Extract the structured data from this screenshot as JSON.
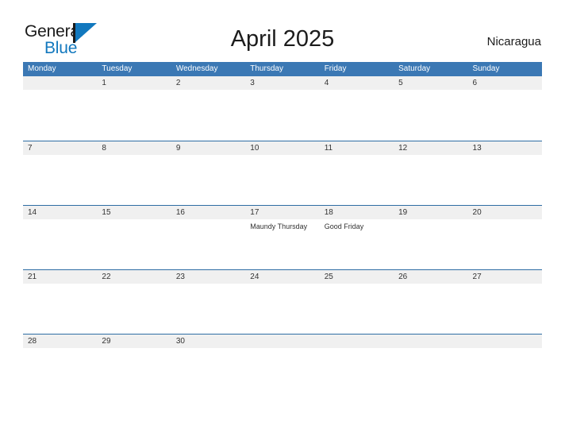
{
  "brand": {
    "name_part1": "General",
    "name_part2": "Blue",
    "triangle_color": "#1278be",
    "text_color": "#1a1a1a"
  },
  "header": {
    "title": "April 2025",
    "location": "Nicaragua",
    "header_bg": "#3b78b4",
    "row_divider_color": "#2e6da4",
    "band_color": "#f0f0f0"
  },
  "weekdays": [
    {
      "label": "Monday"
    },
    {
      "label": "Tuesday"
    },
    {
      "label": "Wednesday"
    },
    {
      "label": "Thursday"
    },
    {
      "label": "Friday"
    },
    {
      "label": "Saturday"
    },
    {
      "label": "Sunday"
    }
  ],
  "weeks": [
    [
      {
        "date": "",
        "events": []
      },
      {
        "date": "1",
        "events": []
      },
      {
        "date": "2",
        "events": []
      },
      {
        "date": "3",
        "events": []
      },
      {
        "date": "4",
        "events": []
      },
      {
        "date": "5",
        "events": []
      },
      {
        "date": "6",
        "events": []
      }
    ],
    [
      {
        "date": "7",
        "events": []
      },
      {
        "date": "8",
        "events": []
      },
      {
        "date": "9",
        "events": []
      },
      {
        "date": "10",
        "events": []
      },
      {
        "date": "11",
        "events": []
      },
      {
        "date": "12",
        "events": []
      },
      {
        "date": "13",
        "events": []
      }
    ],
    [
      {
        "date": "14",
        "events": []
      },
      {
        "date": "15",
        "events": []
      },
      {
        "date": "16",
        "events": []
      },
      {
        "date": "17",
        "events": [
          "Maundy Thursday"
        ]
      },
      {
        "date": "18",
        "events": [
          "Good Friday"
        ]
      },
      {
        "date": "19",
        "events": []
      },
      {
        "date": "20",
        "events": []
      }
    ],
    [
      {
        "date": "21",
        "events": []
      },
      {
        "date": "22",
        "events": []
      },
      {
        "date": "23",
        "events": []
      },
      {
        "date": "24",
        "events": []
      },
      {
        "date": "25",
        "events": []
      },
      {
        "date": "26",
        "events": []
      },
      {
        "date": "27",
        "events": []
      }
    ],
    [
      {
        "date": "28",
        "events": []
      },
      {
        "date": "29",
        "events": []
      },
      {
        "date": "30",
        "events": []
      },
      {
        "date": "",
        "events": []
      },
      {
        "date": "",
        "events": []
      },
      {
        "date": "",
        "events": []
      },
      {
        "date": "",
        "events": []
      }
    ]
  ]
}
